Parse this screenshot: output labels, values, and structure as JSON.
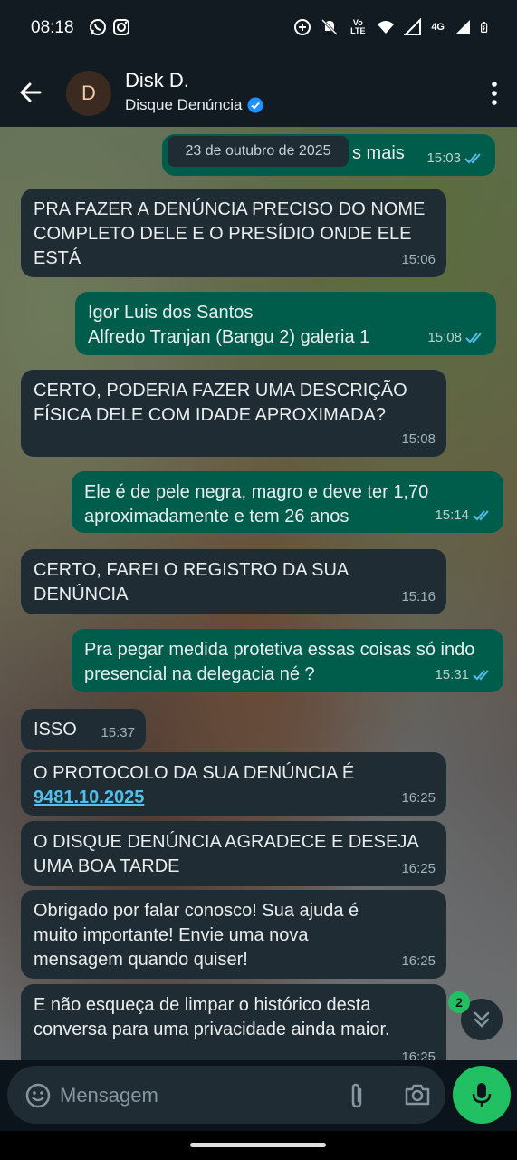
{
  "status_bar": {
    "time": "08:18",
    "network": "4G",
    "volte": "Vo LTE"
  },
  "header": {
    "avatar_initial": "D",
    "contact_name": "Disk D.",
    "contact_subtitle": "Disque Denúncia"
  },
  "chat": {
    "date_chip": "23 de outubro de 2025",
    "messages": [
      {
        "dir": "out",
        "text": "s mais",
        "time": "15:03"
      },
      {
        "dir": "in",
        "text": "PRA FAZER A DENÚNCIA PRECISO DO NOME COMPLETO DELE E O PRESÍDIO ONDE ELE ESTÁ",
        "time": "15:06"
      },
      {
        "dir": "out",
        "line1": "Igor Luis dos Santos",
        "line2": "Alfredo Tranjan (Bangu 2) galeria 1",
        "time": "15:08"
      },
      {
        "dir": "in",
        "text": "CERTO, PODERIA FAZER UMA DESCRIÇÃO FÍSICA DELE COM IDADE APROXIMADA?",
        "time": "15:08"
      },
      {
        "dir": "out",
        "text": "Ele é de pele negra, magro e deve ter 1,70 aproximadamente e tem 26 anos",
        "time": "15:14"
      },
      {
        "dir": "in",
        "text": "CERTO, FAREI O REGISTRO DA SUA DENÚNCIA",
        "time": "15:16"
      },
      {
        "dir": "out",
        "text": "Pra pegar medida protetiva essas coisas só indo presencial na delegacia né ?",
        "time": "15:31"
      },
      {
        "dir": "in",
        "text": "ISSO",
        "time": "15:37"
      },
      {
        "dir": "in",
        "text": "O PROTOCOLO DA SUA DENÚNCIA É",
        "link": "9481.10.2025",
        "time": "16:25"
      },
      {
        "dir": "in",
        "text": "O DISQUE DENÚNCIA AGRADECE E DESEJA UMA BOA TARDE",
        "time": "16:25"
      },
      {
        "dir": "in",
        "text": "Obrigado por falar conosco! Sua ajuda é muito importante! Envie uma nova mensagem quando quiser!",
        "time": "16:25"
      },
      {
        "dir": "in",
        "text": "E não esqueça de limpar o histórico desta conversa para uma privacidade ainda maior.",
        "time": "16:25"
      }
    ],
    "unread_badge": "2"
  },
  "composer": {
    "placeholder": "Mensagem"
  },
  "colors": {
    "incoming_bubble": "#1f2c34",
    "outgoing_bubble": "#005c4b",
    "accent_green": "#21c063",
    "link_blue": "#53bdeb",
    "read_ticks": "#53bdeb"
  },
  "icons": [
    "whatsapp-icon",
    "instagram-icon",
    "back-arrow-icon",
    "verified-badge-icon",
    "more-vert-icon",
    "double-check-icon",
    "chevrons-down-icon",
    "emoji-icon",
    "attach-icon",
    "camera-icon",
    "mic-icon"
  ]
}
